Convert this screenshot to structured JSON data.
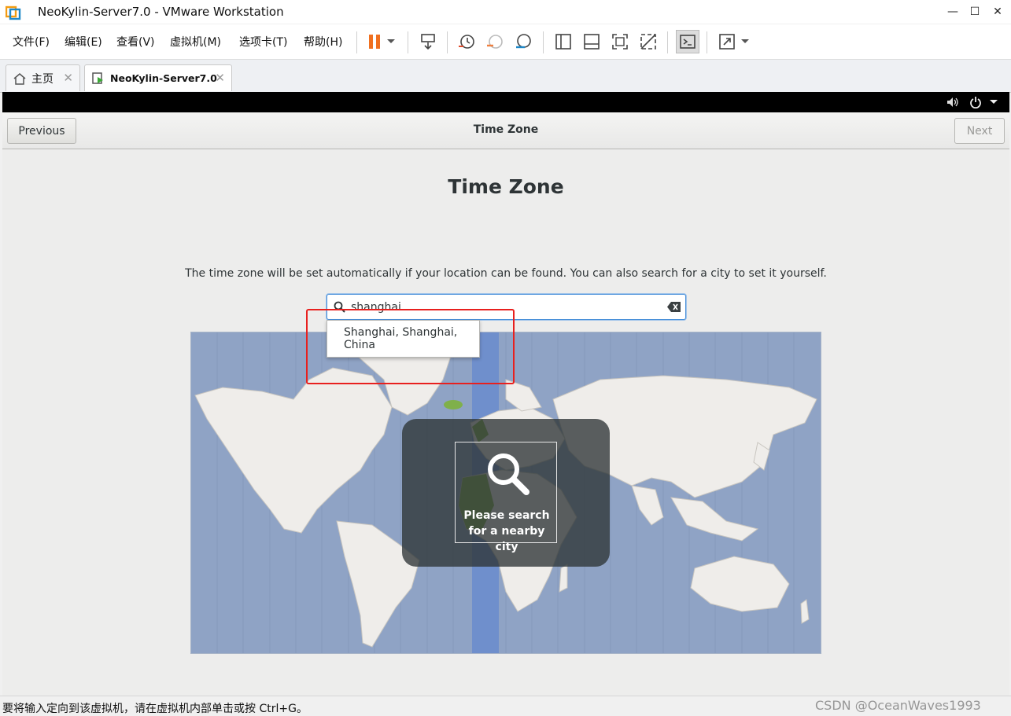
{
  "window": {
    "title": "NeoKylin-Server7.0 - VMware Workstation"
  },
  "menu": [
    "文件(F)",
    "编辑(E)",
    "查看(V)",
    "虚拟机(M)",
    "选项卡(T)",
    "帮助(H)"
  ],
  "tabs": [
    {
      "label": "主页",
      "icon": "home-icon"
    },
    {
      "label": "NeoKylin-Server7.0",
      "icon": "vm-running-icon"
    }
  ],
  "installer": {
    "previous_label": "Previous",
    "header_title": "Time Zone",
    "next_label": "Next",
    "heading": "Time Zone",
    "description": "The time zone will be set automatically if your location can be found. You can also search for a city to set it yourself.",
    "search_value": "shanghai",
    "suggestion": "Shanghai, Shanghai, China",
    "overlay_text": "Please search for a nearby city"
  },
  "status": {
    "text": "要将输入定向到该虚拟机，请在虚拟机内部单击或按 Ctrl+G。",
    "watermark": "CSDN @OceanWaves1993"
  },
  "colors": {
    "accent": "#4a90d9",
    "annotation": "#e8201e",
    "map_ocean": "#8fa3c5",
    "map_land": "#efedea",
    "highlight_band": "#6f8fcc"
  }
}
